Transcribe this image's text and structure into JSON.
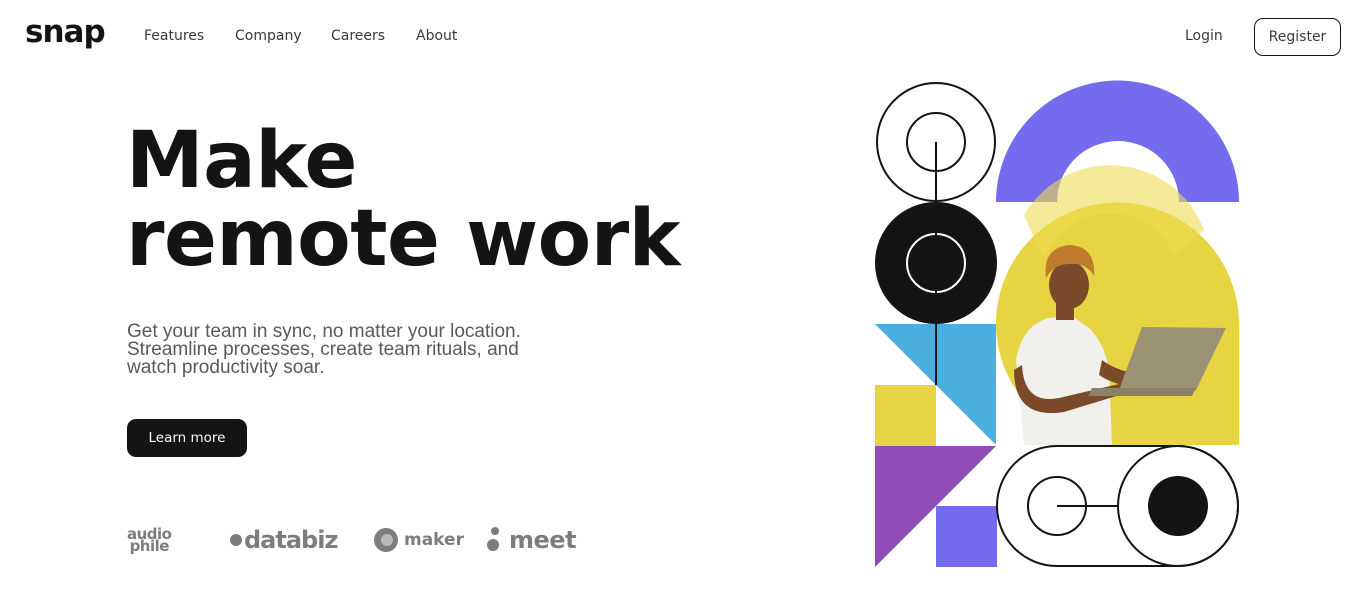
{
  "brand": {
    "name": "snap"
  },
  "nav": {
    "items": [
      {
        "label": "Features"
      },
      {
        "label": "Company"
      },
      {
        "label": "Careers"
      },
      {
        "label": "About"
      }
    ]
  },
  "auth": {
    "login_label": "Login",
    "register_label": "Register"
  },
  "hero": {
    "headline_line1": "Make",
    "headline_line2": "remote work",
    "subtext_line1": "Get your team in sync, no matter your location.",
    "subtext_line2": "Streamline processes, create team rituals, and",
    "subtext_line3": "watch productivity soar.",
    "cta_label": "Learn more"
  },
  "clients": [
    {
      "name": "audiophile",
      "line1": "audio",
      "line2": "phile"
    },
    {
      "name": "databiz",
      "text": "databiz"
    },
    {
      "name": "maker",
      "text": "maker"
    },
    {
      "name": "meet",
      "text": "meet"
    }
  ],
  "colors": {
    "dark": "#141414",
    "purple": "#736cee",
    "yellow": "#e7d442",
    "blue": "#4aaede",
    "violet": "#8f4cb8",
    "gray_text": "#5a5a5a"
  },
  "illustration": {
    "icon": "geometric-illustration",
    "photo": "person-with-laptop"
  }
}
